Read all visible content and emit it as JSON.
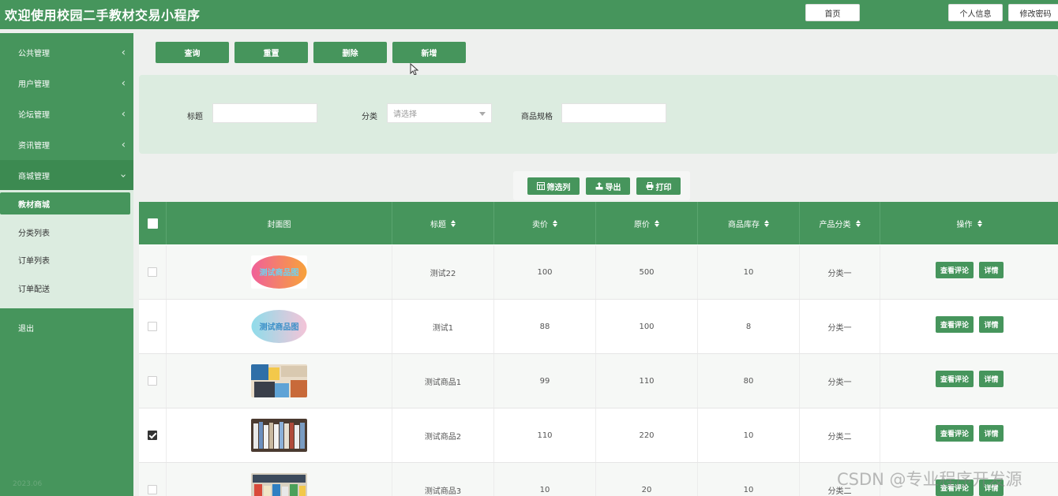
{
  "header": {
    "title": "欢迎使用校园二手教材交易小程序",
    "home": "首页",
    "profile": "个人信息",
    "change_password": "修改密码"
  },
  "sidebar": {
    "items": [
      {
        "label": "公共管理"
      },
      {
        "label": "用户管理"
      },
      {
        "label": "论坛管理"
      },
      {
        "label": "资讯管理"
      },
      {
        "label": "商城管理"
      }
    ],
    "sub_items": [
      {
        "label": "教材商城"
      },
      {
        "label": "分类列表"
      },
      {
        "label": "订单列表"
      },
      {
        "label": "订单配送"
      }
    ],
    "logout": "退出",
    "faint_text": "2023.06"
  },
  "actions": {
    "query": "查询",
    "reset": "重置",
    "delete": "删除",
    "add": "新增"
  },
  "search": {
    "title_label": "标题",
    "category_label": "分类",
    "category_placeholder": "请选择",
    "spec_label": "商品规格"
  },
  "tools": {
    "filter": "筛选列",
    "export": "导出",
    "print": "打印"
  },
  "table": {
    "headers": {
      "cover": "封面图",
      "title": "标题",
      "price": "卖价",
      "original": "原价",
      "stock": "商品库存",
      "category": "产品分类",
      "ops": "操作"
    },
    "rows": [
      {
        "title": "测试22",
        "price": "100",
        "original": "500",
        "stock": "10",
        "category": "分类一",
        "checked": false,
        "cover_text": "测试商品图"
      },
      {
        "title": "测试1",
        "price": "88",
        "original": "100",
        "stock": "8",
        "category": "分类一",
        "checked": false,
        "cover_text": "测试商品图"
      },
      {
        "title": "测试商品1",
        "price": "99",
        "original": "110",
        "stock": "80",
        "category": "分类一",
        "checked": false
      },
      {
        "title": "测试商品2",
        "price": "110",
        "original": "220",
        "stock": "10",
        "category": "分类二",
        "checked": true
      },
      {
        "title": "测试商品3",
        "price": "10",
        "original": "20",
        "stock": "10",
        "category": "分类二",
        "checked": false
      }
    ],
    "op_review": "查看评论",
    "op_detail": "详情"
  },
  "watermark": "CSDN @专业程序开发源",
  "colors": {
    "primary": "#46955c",
    "panel": "#dcece0"
  }
}
